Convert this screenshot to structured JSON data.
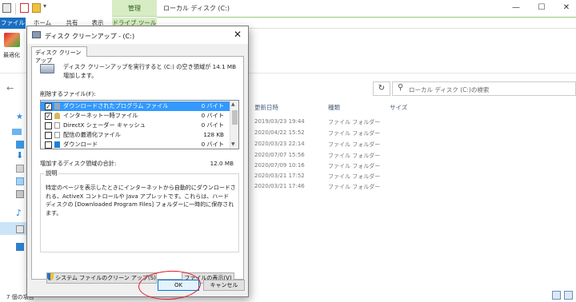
{
  "explorer": {
    "window_title": "ローカル ディスク (C:)",
    "manage_label": "管理",
    "tabs": [
      "ファイル",
      "ホーム",
      "共有",
      "表示",
      "ドライブ ツール"
    ],
    "optimize_label": "最適化",
    "search_placeholder": "ローカル ディスク (C:)の検索",
    "columns": [
      "更新日時",
      "種類",
      "サイズ"
    ],
    "rows": [
      {
        "date": "2019/03/23 19:44",
        "type": "ファイル フォルダー"
      },
      {
        "date": "2020/04/22 15:52",
        "type": "ファイル フォルダー"
      },
      {
        "date": "2020/03/23 22:14",
        "type": "ファイル フォルダー"
      },
      {
        "date": "2020/07/07 15:56",
        "type": "ファイル フォルダー"
      },
      {
        "date": "2020/07/09 10:16",
        "type": "ファイル フォルダー"
      },
      {
        "date": "2020/03/21 17:52",
        "type": "ファイル フォルダー"
      },
      {
        "date": "2020/03/21 17:46",
        "type": "ファイル フォルダー"
      }
    ],
    "item_count": "7 個の項目"
  },
  "dialog": {
    "title": "ディスク クリーンアップ - (C:)",
    "tab_label": "ディスク クリーンアップ",
    "description": "ディスク クリーンアップを実行すると (C:) の空き領域が 14.1 MB 増加します。",
    "files_label": "削除するファイル(F):",
    "files": [
      {
        "checked": true,
        "name": "ダウンロードされたプログラム ファイル",
        "size": "0 バイト",
        "selected": true
      },
      {
        "checked": true,
        "name": "インターネット一時ファイル",
        "size": "0 バイト",
        "selected": false
      },
      {
        "checked": false,
        "name": "DirectX シェーダー キャッシュ",
        "size": "0 バイト",
        "selected": false
      },
      {
        "checked": false,
        "name": "配信の最適化ファイル",
        "size": "128 KB",
        "selected": false
      },
      {
        "checked": false,
        "name": "ダウンロード",
        "size": "0 バイト",
        "selected": false
      }
    ],
    "gain_label": "増加するディスク領域の合計:",
    "gain_value": "12.0 MB",
    "desc_group_label": "説明",
    "desc_text": "特定のページを表示したときにインターネットから自動的にダウンロードされる、ActiveX コントロールや Java アプレットです。これらは、ハード ディスクの [Downloaded Program Files] フォルダーに一時的に保存されます。",
    "system_clean_label": "システム ファイルのクリーン アップ(S)",
    "view_files_label": "ファイルの表示(V)",
    "ok_label": "OK",
    "cancel_label": "キャンセル"
  },
  "colors": {
    "accent": "#0078d7",
    "selection": "#3399ff",
    "manage_tab": "#d7ecc4",
    "annotation": "#e0192c"
  }
}
